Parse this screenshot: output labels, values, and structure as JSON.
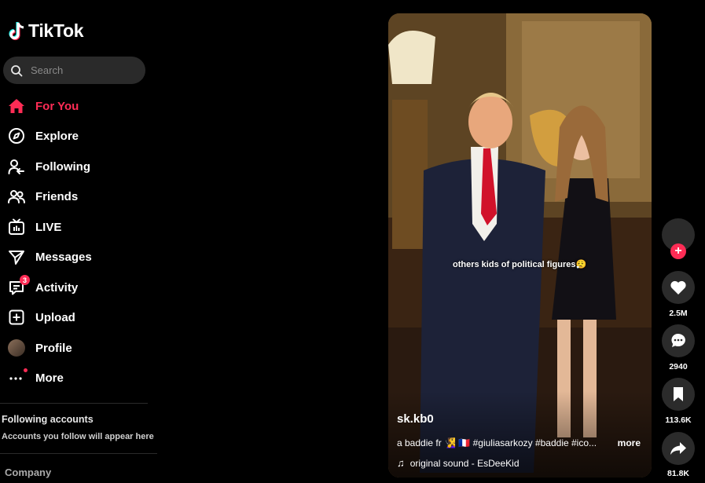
{
  "app": {
    "name": "TikTok"
  },
  "search": {
    "placeholder": "Search"
  },
  "nav": [
    {
      "label": "For You",
      "icon": "home-icon",
      "active": true
    },
    {
      "label": "Explore",
      "icon": "compass-icon"
    },
    {
      "label": "Following",
      "icon": "following-icon"
    },
    {
      "label": "Friends",
      "icon": "friends-icon"
    },
    {
      "label": "LIVE",
      "icon": "live-tv-icon"
    },
    {
      "label": "Messages",
      "icon": "paper-plane-icon"
    },
    {
      "label": "Activity",
      "icon": "inbox-icon",
      "badge": "3"
    },
    {
      "label": "Upload",
      "icon": "plus-square-icon"
    },
    {
      "label": "Profile",
      "icon": "avatar"
    },
    {
      "label": "More",
      "icon": "more-dots-icon"
    }
  ],
  "following_accounts": {
    "title": "Following accounts",
    "subtitle": "Accounts you follow will appear here"
  },
  "company": "Company",
  "video": {
    "overlay_caption": "others kids of political figures😮‍💨",
    "author": "sk.kb0",
    "description": "a baddie fr 🧏‍♀️ 🇫🇷 #giuliasarkozy #baddie #ico...",
    "more_label": "more",
    "music": "original sound - EsDeeKid"
  },
  "actions": {
    "likes": "2.5M",
    "comments": "2940",
    "saves": "113.6K",
    "shares": "81.8K"
  },
  "colors": {
    "accent": "#fe2c55",
    "background": "#000000",
    "surface": "#2b2b2b"
  }
}
